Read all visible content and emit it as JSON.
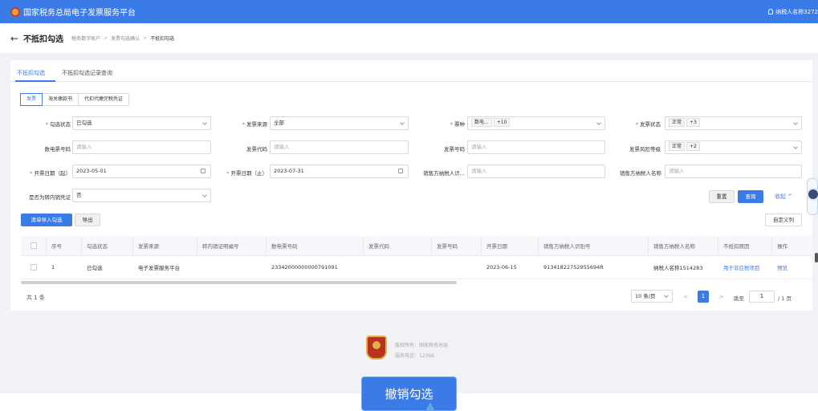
{
  "topbar": {
    "title": "国家税务总局电子发票服务平台",
    "user": "纳税人名称3272"
  },
  "header": {
    "back": "←",
    "title": "不抵扣勾选",
    "breadcrumb": [
      "税务数字账户",
      "发票勾选确认",
      "不抵扣勾选"
    ],
    "sep": ">"
  },
  "tabs": [
    "不抵扣勾选",
    "不抵扣勾选记录查询"
  ],
  "subtabs": [
    "发票",
    "海关缴款书",
    "代扣代缴完税凭证"
  ],
  "filters": {
    "check_status": {
      "label": "勾选状态",
      "value": "已勾选"
    },
    "invoice_source": {
      "label": "发票来源",
      "value": "全部"
    },
    "invoice_type": {
      "label": "票种",
      "tag": "数电...",
      "more": "+10"
    },
    "invoice_status": {
      "label": "发票状态",
      "tag": "正常",
      "more": "+3"
    },
    "digital_no": {
      "label": "数电票号码",
      "placeholder": "请输入"
    },
    "invoice_code": {
      "label": "发票代码",
      "placeholder": "请输入"
    },
    "invoice_no": {
      "label": "发票号码",
      "placeholder": "请输入"
    },
    "risk_level": {
      "label": "发票风险等级",
      "tag": "正常",
      "more": "+2"
    },
    "date_start": {
      "label": "开票日期（起）",
      "value": "2023-05-01"
    },
    "date_end": {
      "label": "开票日期（止）",
      "value": "2023-07-31"
    },
    "seller_tax_id": {
      "label": "销售方纳税人识...",
      "placeholder": "请输入"
    },
    "seller_name": {
      "label": "销售方纳税人名称",
      "placeholder": "请输入"
    },
    "transfer_voucher": {
      "label": "是否为转内销凭证",
      "value": "否"
    }
  },
  "buttons": {
    "reset": "重置",
    "query": "查询",
    "collapse": "收起 ^",
    "import_check": "清单导入勾选",
    "export": "导出",
    "custom_columns": "自定义列"
  },
  "table": {
    "headers": [
      "序号",
      "勾选状态",
      "发票来源",
      "转内销证明编号",
      "数电票号码",
      "发票代码",
      "发票号码",
      "开票日期",
      "销售方纳税人识别号",
      "销售方纳税人名称",
      "不抵扣原因",
      "操作"
    ],
    "rows": [
      {
        "index": "1",
        "status": "已勾选",
        "source": "电子发票服务平台",
        "transfer_no": "",
        "digital_no": "23342000000000791091",
        "code": "",
        "number": "",
        "date": "2023-06-15",
        "seller_id": "91341822752955694R",
        "seller_name": "纳税人名称1514283",
        "reason": "用于非应税项目",
        "action": "预览"
      }
    ]
  },
  "pagination": {
    "total": "共 1 条",
    "page_size": "10 条/页",
    "prev": "<",
    "current": "1",
    "next": ">",
    "goto_label": "跳至",
    "goto_value": "1",
    "total_pages": "/ 1 页"
  },
  "footer": {
    "copyright": "版权所有：国家税务总局",
    "hotline": "服务电话：12366"
  },
  "overlay": {
    "label": "撤销勾选"
  },
  "colors": {
    "primary": "#3b7be8",
    "required": "#e34d4d"
  }
}
